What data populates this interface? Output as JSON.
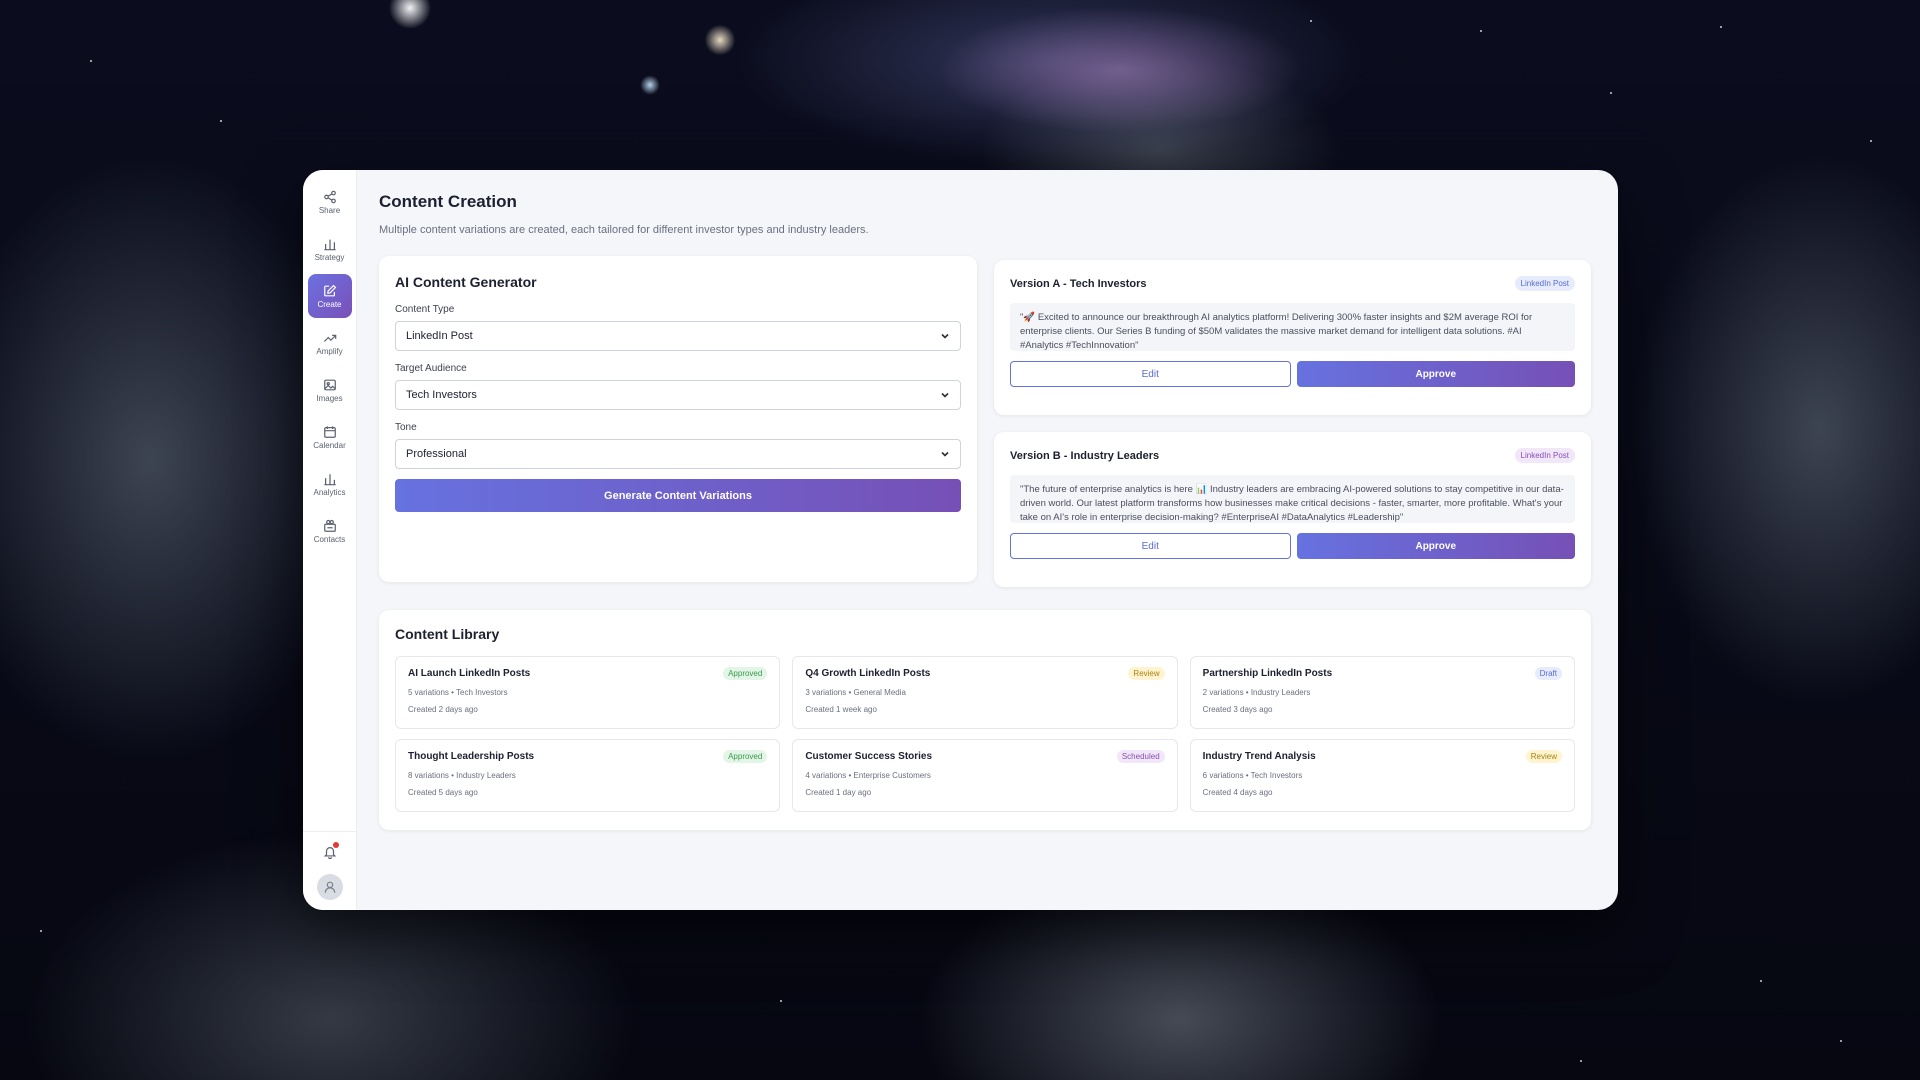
{
  "sidebar": {
    "items": [
      {
        "label": "Share",
        "icon": "share-icon"
      },
      {
        "label": "Strategy",
        "icon": "bar-chart-icon"
      },
      {
        "label": "Create",
        "icon": "edit-icon",
        "active": true
      },
      {
        "label": "Amplify",
        "icon": "trending-up-icon"
      },
      {
        "label": "Images",
        "icon": "image-icon"
      },
      {
        "label": "Calendar",
        "icon": "calendar-icon"
      },
      {
        "label": "Analytics",
        "icon": "bar-chart-icon"
      },
      {
        "label": "Contacts",
        "icon": "contacts-icon"
      }
    ],
    "notification_dot_color": "#e53935"
  },
  "page": {
    "title": "Content Creation",
    "subtitle": "Multiple content variations are created, each tailored for different investor types and industry leaders."
  },
  "generator": {
    "title": "AI Content Generator",
    "content_type_label": "Content Type",
    "content_type_value": "LinkedIn Post",
    "audience_label": "Target Audience",
    "audience_value": "Tech Investors",
    "tone_label": "Tone",
    "tone_value": "Professional",
    "generate_label": "Generate Content Variations"
  },
  "versions": [
    {
      "title": "Version A - Tech Investors",
      "tag": "LinkedIn Post",
      "text": "\"🚀 Excited to announce our breakthrough AI analytics platform! Delivering 300% faster insights and $2M average ROI for enterprise clients. Our Series B funding of $50M validates the massive market demand for intelligent data solutions. #AI #Analytics #TechInnovation\"",
      "edit_label": "Edit",
      "approve_label": "Approve"
    },
    {
      "title": "Version B - Industry Leaders",
      "tag": "LinkedIn Post",
      "text": "\"The future of enterprise analytics is here 📊 Industry leaders are embracing AI-powered solutions to stay competitive in our data-driven world. Our latest platform transforms how businesses make critical decisions - faster, smarter, more profitable. What's your take on AI's role in enterprise decision-making? #EnterpriseAI #DataAnalytics #Leadership\"",
      "edit_label": "Edit",
      "approve_label": "Approve"
    }
  ],
  "library": {
    "title": "Content Library",
    "items": [
      {
        "title": "AI Launch LinkedIn Posts",
        "status": "Approved",
        "meta": "5 variations • Tech Investors",
        "date": "Created 2 days ago"
      },
      {
        "title": "Q4 Growth LinkedIn Posts",
        "status": "Review",
        "meta": "3 variations • General Media",
        "date": "Created 1 week ago"
      },
      {
        "title": "Partnership LinkedIn Posts",
        "status": "Draft",
        "meta": "2 variations • Industry Leaders",
        "date": "Created 3 days ago"
      },
      {
        "title": "Thought Leadership Posts",
        "status": "Approved",
        "meta": "8 variations • Industry Leaders",
        "date": "Created 5 days ago"
      },
      {
        "title": "Customer Success Stories",
        "status": "Scheduled",
        "meta": "4 variations • Enterprise Customers",
        "date": "Created 1 day ago"
      },
      {
        "title": "Industry Trend Analysis",
        "status": "Review",
        "meta": "6 variations • Tech Investors",
        "date": "Created 4 days ago"
      }
    ]
  },
  "colors": {
    "accent_start": "#6672e0",
    "accent_end": "#7650b6",
    "approved": "#3a9a4e",
    "review": "#a78412",
    "draft": "#5a6ccf",
    "scheduled": "#8a4fb5"
  }
}
